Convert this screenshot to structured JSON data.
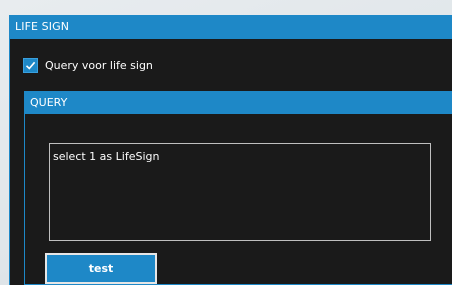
{
  "lifesign": {
    "header": "LIFE SIGN",
    "checkbox_label": "Query voor life sign",
    "checkbox_checked": true
  },
  "query": {
    "header": "QUERY",
    "text": "select 1 as LifeSign"
  },
  "buttons": {
    "test_label": "test"
  },
  "colors": {
    "accent": "#1e88c7",
    "panel_bg": "#1a1a1a",
    "text": "#ffffff"
  }
}
